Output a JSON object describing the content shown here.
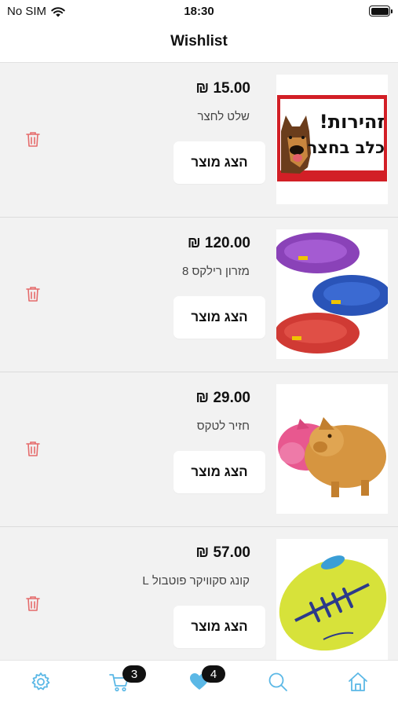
{
  "status_bar": {
    "carrier": "No SIM",
    "time": "18:30",
    "icons": [
      "wifi-icon",
      "battery-icon"
    ]
  },
  "header": {
    "title": "Wishlist"
  },
  "items": [
    {
      "price": "₪ 15.00",
      "name": "שלט לחצר",
      "button_label": "הצג מוצר",
      "image": "dog-warning-sign",
      "image_text_1": "!זהירות",
      "image_text_2": "כלב בחצר"
    },
    {
      "price": "₪ 120.00",
      "name": "מזרון רילקס 8",
      "button_label": "הצג מוצר",
      "image": "pet-cushions"
    },
    {
      "price": "₪ 29.00",
      "name": "חזיר לטקס",
      "button_label": "הצג מוצר",
      "image": "latex-pig-toys"
    },
    {
      "price": "₪ 57.00",
      "name": "קונג סקוויקר פוטבול L",
      "button_label": "הצג מוצר",
      "image": "kong-football-toy"
    }
  ],
  "tab_bar": {
    "tabs": [
      "settings",
      "cart",
      "wishlist",
      "search",
      "home"
    ],
    "cart_badge": "3",
    "wishlist_badge": "4",
    "active_tab": "wishlist"
  },
  "colors": {
    "accent": "#5bb8e6",
    "trash": "#e56b6b",
    "badge": "#111111",
    "background": "#f2f2f2"
  }
}
